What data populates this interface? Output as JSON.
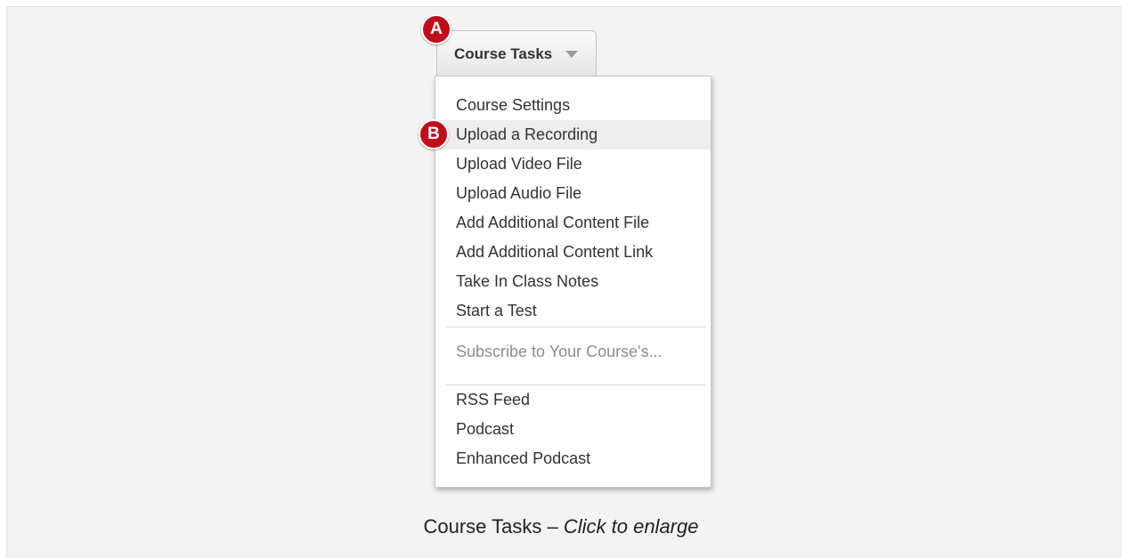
{
  "button": {
    "label": "Course Tasks",
    "caret_icon": "caret-down-icon"
  },
  "badges": {
    "a": "A",
    "b": "B",
    "color": "#c00d1c"
  },
  "menu": {
    "items": [
      {
        "label": "Course Settings"
      },
      {
        "label": "Upload a Recording",
        "highlighted": true
      },
      {
        "label": "Upload Video File"
      },
      {
        "label": "Upload Audio File"
      },
      {
        "label": "Add Additional Content File"
      },
      {
        "label": "Add Additional Content Link"
      },
      {
        "label": "Take In Class Notes"
      },
      {
        "label": "Start a Test"
      }
    ],
    "subscribe_heading": "Subscribe to Your Course's...",
    "subscribe_items": [
      {
        "label": "RSS Feed"
      },
      {
        "label": "Podcast"
      },
      {
        "label": "Enhanced Podcast"
      }
    ]
  },
  "caption": {
    "text": "Course Tasks – ",
    "link": "Click to enlarge"
  }
}
